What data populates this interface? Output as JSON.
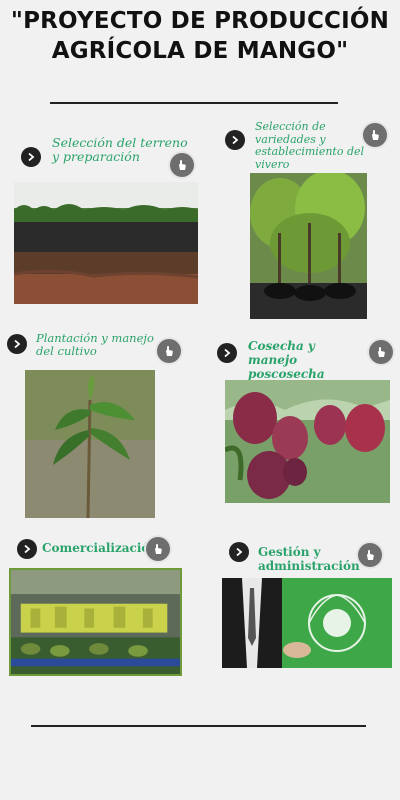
{
  "title": "\"PROYECTO DE PRODUCCIÓN AGRÍCOLA DE MANGO\"",
  "sections": [
    {
      "label": "Selección del terreno y preparación",
      "icon": "arrow-right-icon"
    },
    {
      "label": "Selección de variedades y establecimiento del vivero",
      "icon": "arrow-right-icon"
    },
    {
      "label": "Plantación y manejo del cultivo",
      "icon": "arrow-right-icon"
    },
    {
      "label": "Cosecha y manejo poscosecha",
      "icon": "arrow-right-icon"
    },
    {
      "label": "Comercialización",
      "icon": "arrow-right-icon"
    },
    {
      "label": "Gestión y administración",
      "icon": "arrow-right-icon"
    }
  ],
  "colors": {
    "accent": "#2aa36a",
    "background": "#f1f1f1",
    "rule": "#222222",
    "tap_button": "#6e6e6e"
  },
  "tap_icon": "hand-pointer-icon"
}
